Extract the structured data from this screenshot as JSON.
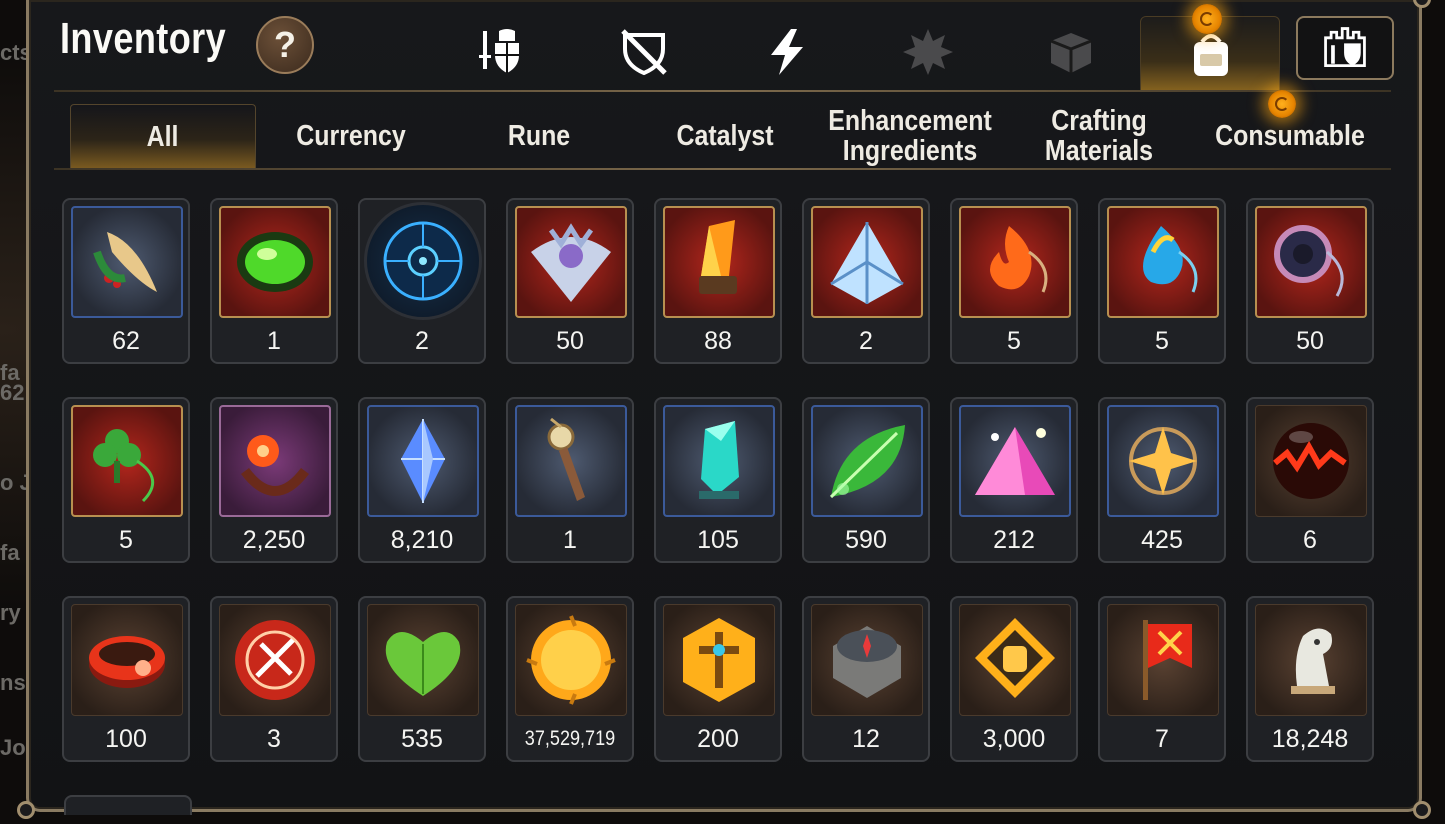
{
  "window": {
    "title": "Inventory",
    "help_label": "?"
  },
  "side_fragments": [
    "cts",
    "fa",
    "62",
    "o J",
    "fa",
    "ry",
    "ns",
    "Jo"
  ],
  "categories": [
    {
      "icon": "sword-shield-icon"
    },
    {
      "icon": "crossed-shield-icon"
    },
    {
      "icon": "lightning-icon"
    },
    {
      "icon": "splash-gem-icon"
    },
    {
      "icon": "cube-icon"
    },
    {
      "icon": "backpack-icon"
    },
    {
      "icon": "castle-shield-icon"
    }
  ],
  "tabs": [
    {
      "label": "All"
    },
    {
      "label": "Currency"
    },
    {
      "label": "Rune"
    },
    {
      "label": "Catalyst"
    },
    {
      "label": "Enhancement\nIngredients"
    },
    {
      "label": "Crafting\nMaterials"
    },
    {
      "label": "Consumable"
    }
  ],
  "items": [
    {
      "icon": "feather-herb-icon",
      "quality": "blue",
      "count": "62"
    },
    {
      "icon": "green-gem-icon",
      "quality": "red",
      "count": "1"
    },
    {
      "icon": "blue-rune-circle-icon",
      "quality": "round",
      "count": "2"
    },
    {
      "icon": "eye-crest-icon",
      "quality": "red",
      "count": "50"
    },
    {
      "icon": "orange-crystal-icon",
      "quality": "red",
      "count": "88"
    },
    {
      "icon": "triangle-crystal-icon",
      "quality": "red",
      "count": "2"
    },
    {
      "icon": "fire-charm-icon",
      "quality": "red",
      "count": "5"
    },
    {
      "icon": "water-charm-icon",
      "quality": "red",
      "count": "5"
    },
    {
      "icon": "ring-charm-icon",
      "quality": "red",
      "count": "50"
    },
    {
      "icon": "clover-charm-icon",
      "quality": "red",
      "count": "5"
    },
    {
      "icon": "flower-ring-icon",
      "quality": "purple",
      "count": "2,250"
    },
    {
      "icon": "blue-crystal-icon",
      "quality": "blue",
      "count": "8,210"
    },
    {
      "icon": "pendulum-icon",
      "quality": "blue",
      "count": "1"
    },
    {
      "icon": "teal-crystal-icon",
      "quality": "blue",
      "count": "105"
    },
    {
      "icon": "green-leaf-icon",
      "quality": "blue",
      "count": "590"
    },
    {
      "icon": "pink-pyramid-icon",
      "quality": "blue",
      "count": "212"
    },
    {
      "icon": "star-pendant-icon",
      "quality": "blue",
      "count": "425"
    },
    {
      "icon": "lava-orb-icon",
      "quality": "brown",
      "count": "6"
    },
    {
      "icon": "red-bracelet-icon",
      "quality": "brown",
      "count": "100"
    },
    {
      "icon": "red-seal-icon",
      "quality": "brown",
      "count": "3"
    },
    {
      "icon": "green-heart-icon",
      "quality": "brown",
      "count": "535"
    },
    {
      "icon": "gold-coin-icon",
      "quality": "brown",
      "count": "37,529,719"
    },
    {
      "icon": "gold-hexagon-icon",
      "quality": "brown",
      "count": "200"
    },
    {
      "icon": "compass-icon",
      "quality": "brown",
      "count": "12"
    },
    {
      "icon": "fist-emblem-icon",
      "quality": "brown",
      "count": "3,000"
    },
    {
      "icon": "banner-icon",
      "quality": "brown",
      "count": "7"
    },
    {
      "icon": "knight-chess-icon",
      "quality": "brown",
      "count": "18,248"
    }
  ],
  "colors": {
    "accent_gold": "#c89a3a",
    "frame": "#8a7b62",
    "badge": "#ffa51a"
  }
}
